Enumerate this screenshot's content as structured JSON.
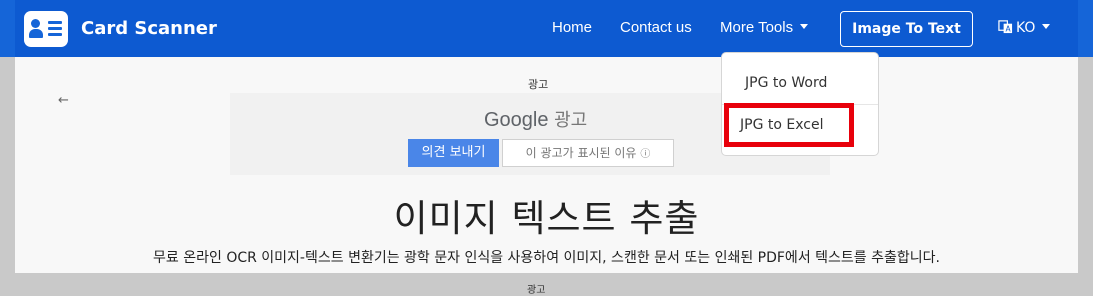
{
  "header": {
    "brand": "Card Scanner",
    "nav": {
      "home": "Home",
      "contact": "Contact us",
      "more_tools": "More Tools"
    },
    "image_to_text_button": "Image To Text",
    "language": "KO"
  },
  "dropdown": {
    "items": [
      "JPG to Word",
      "JPG to Excel"
    ],
    "highlighted_item": "JPG to Excel",
    "highlight_color": "#e8000b"
  },
  "ad": {
    "label": "광고",
    "google_ads_brand": "Google",
    "google_ads_suffix": "광고",
    "feedback_button": "의견 보내기",
    "why_this_ad": "이 광고가 표시된 이유",
    "back_arrow": "←"
  },
  "main": {
    "title": "이미지 텍스트 추출",
    "description": "무료 온라인 OCR 이미지-텍스트 변환기는 광학 문자 인식을 사용하여 이미지, 스캔한 문서 또는 인쇄된 PDF에서 텍스트를 추출합니다.",
    "cut_off_text": "광고"
  },
  "colors": {
    "navbar": "#0d5ad1",
    "feedback_button": "#4a86e8"
  }
}
